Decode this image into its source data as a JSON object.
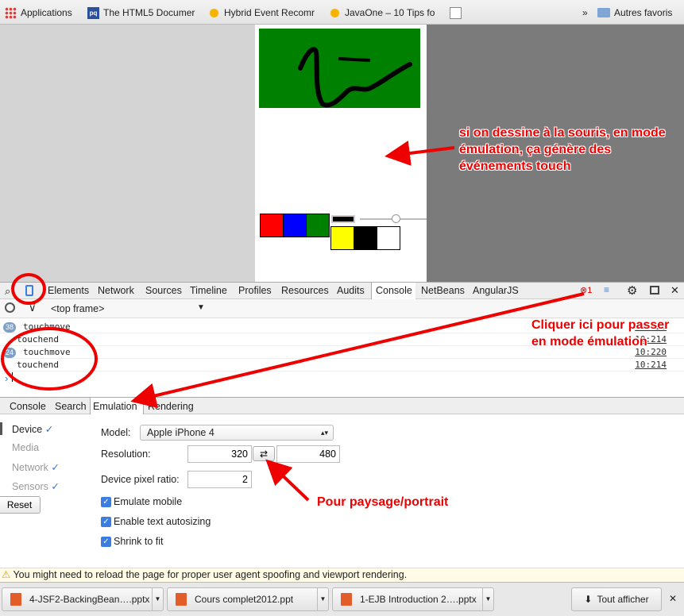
{
  "bookmarks": {
    "items": [
      {
        "label": "Applications",
        "icon": "apps-grid-icon"
      },
      {
        "label": "The HTML5 Documer",
        "icon": "pq-icon"
      },
      {
        "label": "Hybrid Event Recomr",
        "icon": "puzzle-star-icon"
      },
      {
        "label": "JavaOne – 10 Tips fo",
        "icon": "puzzle-star-icon"
      },
      {
        "label": "",
        "icon": "document-icon"
      }
    ],
    "overflow": "»",
    "folder": {
      "label": "Autres favoris",
      "icon": "folder-icon"
    }
  },
  "page": {
    "swatch_colors": [
      "#ff0000",
      "#0000ff",
      "#008000"
    ],
    "swatch_colors_2": [
      "#ffff00",
      "#000000",
      "#ffffff"
    ],
    "annotation": "si on dessine à la souris, en mode émulation, ça génère des événements touch"
  },
  "devtools": {
    "tabs": [
      "Elements",
      "Network",
      "Sources",
      "Timeline",
      "Profiles",
      "Resources",
      "Audits",
      "Console",
      "NetBeans",
      "AngularJS"
    ],
    "active_tab": "Console",
    "error_count": "1",
    "frame_selector": "<top frame>",
    "log": [
      {
        "count": "38",
        "message": "touchmove",
        "source": "10:220"
      },
      {
        "count": "",
        "message": "touchend",
        "source": "10:214"
      },
      {
        "count": "24",
        "message": "touchmove",
        "source": "10:220"
      },
      {
        "count": "",
        "message": "touchend",
        "source": "10:214"
      }
    ],
    "prompt": "›",
    "drawer_tabs": [
      "Console",
      "Search",
      "Emulation",
      "Rendering"
    ],
    "drawer_active": "Emulation",
    "annotation_emulation": "Cliquer ici pour passer en mode émulation"
  },
  "emulation": {
    "side": [
      {
        "label": "Device",
        "checked": true
      },
      {
        "label": "Media",
        "checked": false
      },
      {
        "label": "Network",
        "checked": true
      },
      {
        "label": "Sensors",
        "checked": true
      }
    ],
    "reset_label": "Reset",
    "model_label": "Model:",
    "model_value": "Apple iPhone 4",
    "resolution_label": "Resolution:",
    "res_width": "320",
    "res_height": "480",
    "swap_symbol": "⇄",
    "dpr_label": "Device pixel ratio:",
    "dpr_value": "2",
    "checkboxes": [
      "Emulate mobile",
      "Enable text autosizing",
      "Shrink to fit"
    ],
    "annotation_orientation": "Pour paysage/portrait"
  },
  "warning": "You might need to reload the page for proper user agent spoofing and viewport rendering.",
  "downloads": {
    "items": [
      "4-JSF2-BackingBean….pptx",
      "Cours complet2012.ppt",
      "1-EJB Introduction 2….pptx"
    ],
    "show_all": "Tout afficher"
  }
}
